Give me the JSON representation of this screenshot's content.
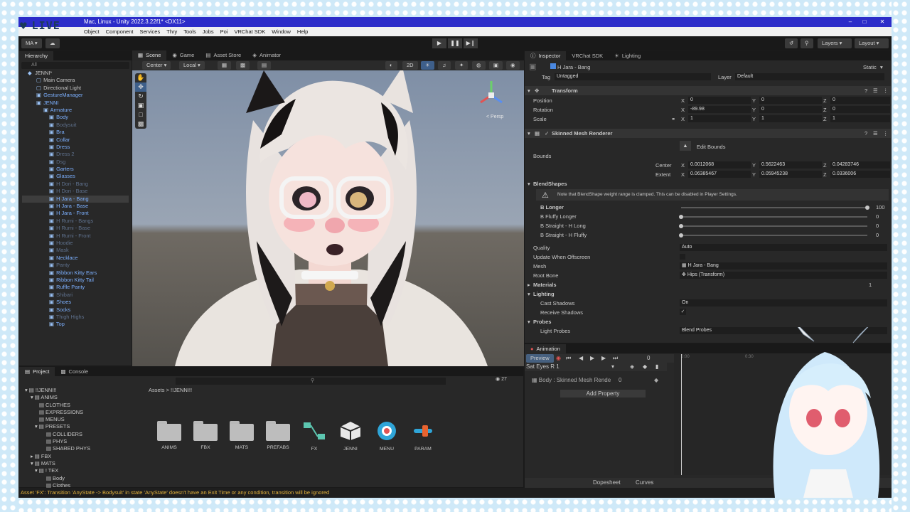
{
  "overlay": {
    "live_label": "LIVE"
  },
  "window": {
    "title": "Mac, Linux - Unity 2022.3.22f1* <DX11>",
    "menu": [
      "Object",
      "Component",
      "Services",
      "Thry",
      "Tools",
      "Jobs",
      "Poi",
      "VRChat SDK",
      "Window",
      "Help"
    ]
  },
  "toolbar": {
    "account": "MA",
    "layers": "Layers",
    "layout": "Layout"
  },
  "hierarchy": {
    "tab": "Hierarchy",
    "search": "All",
    "items": [
      {
        "label": "JENNI*",
        "style": "root"
      },
      {
        "label": "Main Camera",
        "style": "normal"
      },
      {
        "label": "Directional Light",
        "style": "normal"
      },
      {
        "label": "GestureManager",
        "style": "blue"
      },
      {
        "label": "JENNI",
        "style": "blue"
      },
      {
        "label": "Armature",
        "style": "blue"
      },
      {
        "label": "Body",
        "style": "blue"
      },
      {
        "label": "Bodysuit",
        "style": "dim"
      },
      {
        "label": "Bra",
        "style": "blue"
      },
      {
        "label": "Collar",
        "style": "blue"
      },
      {
        "label": "Dress",
        "style": "blue"
      },
      {
        "label": "Dress 2",
        "style": "dim"
      },
      {
        "label": "Dsg",
        "style": "dim"
      },
      {
        "label": "Garters",
        "style": "blue"
      },
      {
        "label": "Glasses",
        "style": "blue"
      },
      {
        "label": "H Dori - Bang",
        "style": "dim"
      },
      {
        "label": "H Dori - Base",
        "style": "dim"
      },
      {
        "label": "H Jara - Bang",
        "style": "sel"
      },
      {
        "label": "H Jara - Base",
        "style": "blue"
      },
      {
        "label": "H Jara - Front",
        "style": "blue"
      },
      {
        "label": "H Rumi - Bangs",
        "style": "dim"
      },
      {
        "label": "H Rumi - Base",
        "style": "dim"
      },
      {
        "label": "H Rumi - Front",
        "style": "dim"
      },
      {
        "label": "Hoodie",
        "style": "dim"
      },
      {
        "label": "Mask",
        "style": "dim"
      },
      {
        "label": "Necklace",
        "style": "blue"
      },
      {
        "label": "Panty",
        "style": "dim"
      },
      {
        "label": "Ribbon Kitty Ears",
        "style": "blue"
      },
      {
        "label": "Ribbon Kitty Tail",
        "style": "blue"
      },
      {
        "label": "Ruffle Panty",
        "style": "blue"
      },
      {
        "label": "Shibari",
        "style": "dim"
      },
      {
        "label": "Shoes",
        "style": "blue"
      },
      {
        "label": "Socks",
        "style": "blue"
      },
      {
        "label": "Thigh Highs",
        "style": "dim"
      },
      {
        "label": "Top",
        "style": "blue"
      }
    ]
  },
  "scene": {
    "tabs": [
      "Scene",
      "Game",
      "Asset Store",
      "Animator"
    ],
    "pivot": "Center",
    "space": "Local",
    "mode_2d": "2D",
    "persp": "< Persp"
  },
  "inspector": {
    "tabs": [
      "Inspector",
      "VRChat SDK",
      "Lighting"
    ],
    "object_name": "H Jara - Bang",
    "static_label": "Static",
    "tag_label": "Tag",
    "tag_value": "Untagged",
    "layer_label": "Layer",
    "layer_value": "Default",
    "transform": {
      "title": "Transform",
      "position": {
        "label": "Position",
        "x": "0",
        "y": "0",
        "z": "0"
      },
      "rotation": {
        "label": "Rotation",
        "x": "-89.98",
        "y": "0",
        "z": "0"
      },
      "scale": {
        "label": "Scale",
        "x": "1",
        "y": "1",
        "z": "1"
      }
    },
    "smr": {
      "title": "Skinned Mesh Renderer",
      "edit_bounds": "Edit Bounds",
      "bounds_label": "Bounds",
      "center": {
        "label": "Center",
        "x": "0.0012068",
        "y": "0.5622463",
        "z": "0.04283746"
      },
      "extent": {
        "label": "Extent",
        "x": "0.06385467",
        "y": "0.05945238",
        "z": "0.0336006"
      },
      "blendshapes_title": "BlendShapes",
      "blend_note": "Note that BlendShape weight range is clamped. This can be disabled in Player Settings.",
      "blendshapes": [
        {
          "name": "B Longer",
          "value": 100,
          "display": "100"
        },
        {
          "name": "B Fluffy Longer",
          "value": 0,
          "display": "0"
        },
        {
          "name": "B Straight - H Long",
          "value": 0,
          "display": "0"
        },
        {
          "name": "B Straight - H Fluffy",
          "value": 0,
          "display": "0"
        }
      ],
      "quality_label": "Quality",
      "quality_value": "Auto",
      "offscreen_label": "Update When Offscreen",
      "mesh_label": "Mesh",
      "mesh_value": "H Jara - Bang",
      "rootbone_label": "Root Bone",
      "rootbone_value": "Hips (Transform)",
      "materials_label": "Materials",
      "materials_count": "1",
      "lighting_label": "Lighting",
      "cast_label": "Cast Shadows",
      "cast_value": "On",
      "receive_label": "Receive Shadows",
      "probes_label": "Probes",
      "light_probes_label": "Light Probes",
      "light_probes_value": "Blend Probes"
    }
  },
  "animation": {
    "tab": "Animation",
    "preview": "Preview",
    "frame": "0",
    "clip": "Sat Eyes R 1",
    "property": "Body : Skinned Mesh Rende",
    "property_value": "0",
    "add_property": "Add Property",
    "time_marks": [
      "0:00",
      "0:30"
    ],
    "dopesheet": "Dopesheet",
    "curves": "Curves"
  },
  "project": {
    "tabs": [
      "Project",
      "Console"
    ],
    "root": "!!JENNI!!",
    "tree": [
      {
        "label": "!!JENNI!!",
        "depth": 0
      },
      {
        "label": "ANIMS",
        "depth": 1
      },
      {
        "label": "CLOTHES",
        "depth": 2
      },
      {
        "label": "EXPRESSIONS",
        "depth": 2
      },
      {
        "label": "MENUS",
        "depth": 2
      },
      {
        "label": "PRESETS",
        "depth": 2
      },
      {
        "label": "COLLIDERS",
        "depth": 3
      },
      {
        "label": "PHYS",
        "depth": 3
      },
      {
        "label": "SHARED PHYS",
        "depth": 3
      },
      {
        "label": "FBX",
        "depth": 1
      },
      {
        "label": "MATS",
        "depth": 1
      },
      {
        "label": "! TEX",
        "depth": 2
      },
      {
        "label": "Body",
        "depth": 3
      },
      {
        "label": "Clothes",
        "depth": 3
      }
    ],
    "breadcrumb": "Assets > !!JENNI!!",
    "count": "27",
    "assets": [
      {
        "label": "ANIMS",
        "kind": "folder"
      },
      {
        "label": "FBX",
        "kind": "folder"
      },
      {
        "label": "MATS",
        "kind": "folder"
      },
      {
        "label": "PREFABS",
        "kind": "folder"
      },
      {
        "label": "FX",
        "kind": "fx"
      },
      {
        "label": "JENNI",
        "kind": "unity"
      },
      {
        "label": "MENU",
        "kind": "menu"
      },
      {
        "label": "PARAM",
        "kind": "param"
      }
    ]
  },
  "status": {
    "message": "Asset 'FX': Transition 'AnyState -> Bodysuit' in state 'AnyState' doesn't have an Exit Time or any condition, transition will be ignored"
  }
}
